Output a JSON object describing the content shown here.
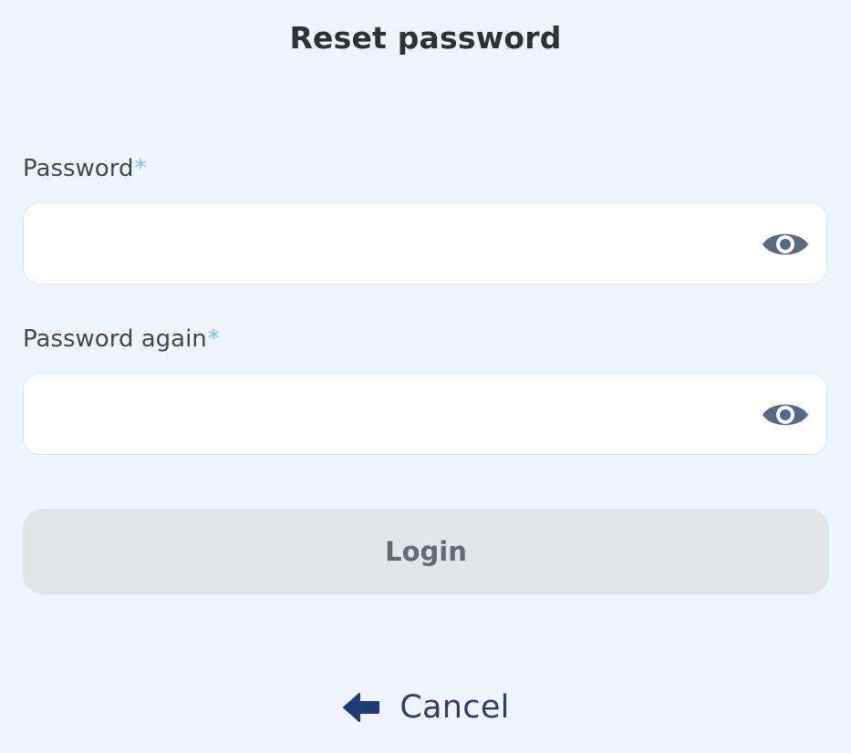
{
  "form": {
    "title": "Reset password",
    "password": {
      "label": "Password",
      "required_mark": "*",
      "value": "",
      "placeholder": ""
    },
    "password_again": {
      "label": "Password again",
      "required_mark": "*",
      "value": "",
      "placeholder": ""
    },
    "submit_label": "Login",
    "cancel_label": "Cancel"
  },
  "icons": {
    "toggle_visibility": "eye-icon",
    "cancel": "arrow-left-icon"
  },
  "colors": {
    "background": "#f0f5fc",
    "required_mark": "#7cc4f0",
    "icon": "#5a6982",
    "button_disabled_bg": "#e2e4e8",
    "button_disabled_text": "#636a73",
    "cancel_text": "#2f3e63",
    "cancel_arrow": "#1e3a78"
  }
}
